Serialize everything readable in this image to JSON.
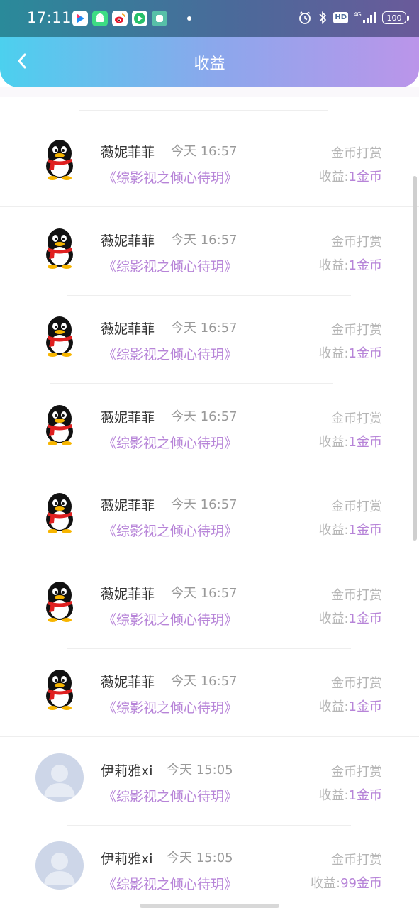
{
  "status_bar": {
    "time": "17:11",
    "network": "4G",
    "hd": "HD",
    "battery": "100",
    "app_icons": [
      "youku-icon",
      "android-icon",
      "weibo-icon",
      "video-player-icon",
      "green-app-icon"
    ]
  },
  "nav": {
    "title": "收益"
  },
  "list": {
    "income_label": "收益:",
    "items": [
      {
        "avatar": "qq-penguin",
        "name": "薇妮菲菲",
        "time": "今天 16:57",
        "book": "《综影视之倾心待玥》",
        "kind": "金币打赏",
        "amount": "1金币"
      },
      {
        "avatar": "qq-penguin",
        "name": "薇妮菲菲",
        "time": "今天 16:57",
        "book": "《综影视之倾心待玥》",
        "kind": "金币打赏",
        "amount": "1金币"
      },
      {
        "avatar": "qq-penguin",
        "name": "薇妮菲菲",
        "time": "今天 16:57",
        "book": "《综影视之倾心待玥》",
        "kind": "金币打赏",
        "amount": "1金币"
      },
      {
        "avatar": "qq-penguin",
        "name": "薇妮菲菲",
        "time": "今天 16:57",
        "book": "《综影视之倾心待玥》",
        "kind": "金币打赏",
        "amount": "1金币"
      },
      {
        "avatar": "qq-penguin",
        "name": "薇妮菲菲",
        "time": "今天 16:57",
        "book": "《综影视之倾心待玥》",
        "kind": "金币打赏",
        "amount": "1金币"
      },
      {
        "avatar": "qq-penguin",
        "name": "薇妮菲菲",
        "time": "今天 16:57",
        "book": "《综影视之倾心待玥》",
        "kind": "金币打赏",
        "amount": "1金币"
      },
      {
        "avatar": "qq-penguin",
        "name": "薇妮菲菲",
        "time": "今天 16:57",
        "book": "《综影视之倾心待玥》",
        "kind": "金币打赏",
        "amount": "1金币"
      },
      {
        "avatar": "default-person",
        "name": "伊莉雅xi",
        "time": "今天 15:05",
        "book": "《综影视之倾心待玥》",
        "kind": "金币打赏",
        "amount": "1金币"
      },
      {
        "avatar": "default-person",
        "name": "伊莉雅xi",
        "time": "今天 15:05",
        "book": "《综影视之倾心待玥》",
        "kind": "金币打赏",
        "amount": "99金币"
      }
    ]
  },
  "colors": {
    "accent_purple": "#b784d8",
    "gradient_start": "#4cd0ee",
    "gradient_end": "#bb95ea"
  }
}
